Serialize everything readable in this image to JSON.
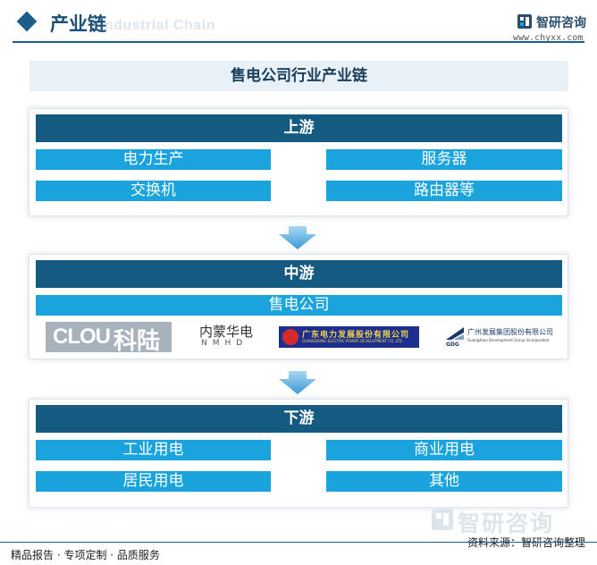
{
  "header": {
    "title": "产业链",
    "subtitle": "Industrial Chain",
    "brand_name": "智研咨询",
    "brand_url": "www.chyxx.com"
  },
  "main_title": "售电公司行业产业链",
  "upstream": {
    "label": "上游",
    "items": [
      "电力生产",
      "服务器",
      "交换机",
      "路由器等"
    ]
  },
  "midstream": {
    "label": "中游",
    "item": "售电公司",
    "logos": {
      "kelu_a": "CLOU",
      "kelu_b": "科陆",
      "nmhd_a": "内蒙华电",
      "nmhd_b": "NMHD",
      "gd_a": "广东电力发展股份有限公司",
      "gd_b": "GUANGDONG ELECTRIC POWER DEVELOPMENT CO.,LTD",
      "gz_tag": "GDG",
      "gz_a": "广州发展集团股份有限公司",
      "gz_b": "Guangzhou Development Group Incorporated"
    }
  },
  "downstream": {
    "label": "下游",
    "items": [
      "工业用电",
      "商业用电",
      "居民用电",
      "其他"
    ]
  },
  "watermark": "智研咨询",
  "source": "资料来源：智研咨询整理",
  "footer": "精品报告 · 专项定制 · 品质服务",
  "colors": {
    "bar": "#155a80",
    "chip": "#1aa3dd",
    "accent": "#1b5e8c"
  }
}
